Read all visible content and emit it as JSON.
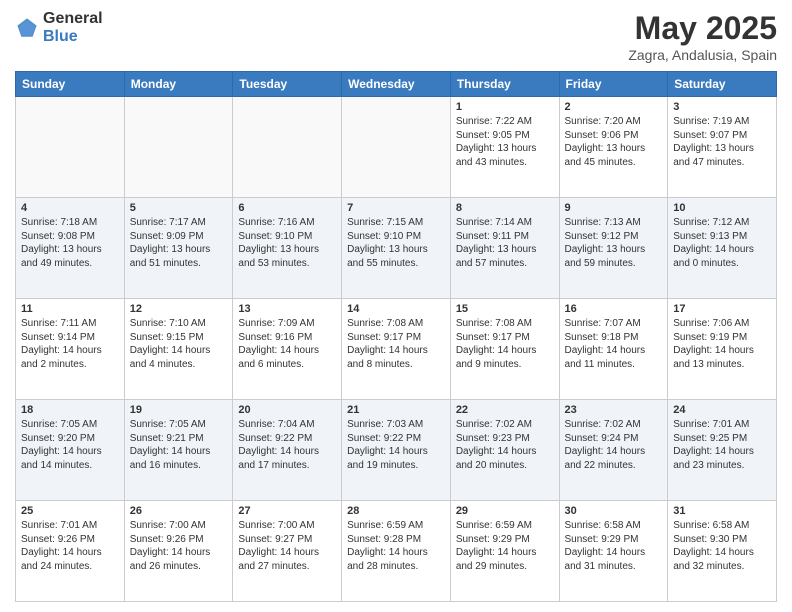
{
  "logo": {
    "general": "General",
    "blue": "Blue"
  },
  "title": "May 2025",
  "location": "Zagra, Andalusia, Spain",
  "days_of_week": [
    "Sunday",
    "Monday",
    "Tuesday",
    "Wednesday",
    "Thursday",
    "Friday",
    "Saturday"
  ],
  "weeks": [
    [
      {
        "day": "",
        "info": ""
      },
      {
        "day": "",
        "info": ""
      },
      {
        "day": "",
        "info": ""
      },
      {
        "day": "",
        "info": ""
      },
      {
        "day": "1",
        "info": "Sunrise: 7:22 AM\nSunset: 9:05 PM\nDaylight: 13 hours\nand 43 minutes."
      },
      {
        "day": "2",
        "info": "Sunrise: 7:20 AM\nSunset: 9:06 PM\nDaylight: 13 hours\nand 45 minutes."
      },
      {
        "day": "3",
        "info": "Sunrise: 7:19 AM\nSunset: 9:07 PM\nDaylight: 13 hours\nand 47 minutes."
      }
    ],
    [
      {
        "day": "4",
        "info": "Sunrise: 7:18 AM\nSunset: 9:08 PM\nDaylight: 13 hours\nand 49 minutes."
      },
      {
        "day": "5",
        "info": "Sunrise: 7:17 AM\nSunset: 9:09 PM\nDaylight: 13 hours\nand 51 minutes."
      },
      {
        "day": "6",
        "info": "Sunrise: 7:16 AM\nSunset: 9:10 PM\nDaylight: 13 hours\nand 53 minutes."
      },
      {
        "day": "7",
        "info": "Sunrise: 7:15 AM\nSunset: 9:10 PM\nDaylight: 13 hours\nand 55 minutes."
      },
      {
        "day": "8",
        "info": "Sunrise: 7:14 AM\nSunset: 9:11 PM\nDaylight: 13 hours\nand 57 minutes."
      },
      {
        "day": "9",
        "info": "Sunrise: 7:13 AM\nSunset: 9:12 PM\nDaylight: 13 hours\nand 59 minutes."
      },
      {
        "day": "10",
        "info": "Sunrise: 7:12 AM\nSunset: 9:13 PM\nDaylight: 14 hours\nand 0 minutes."
      }
    ],
    [
      {
        "day": "11",
        "info": "Sunrise: 7:11 AM\nSunset: 9:14 PM\nDaylight: 14 hours\nand 2 minutes."
      },
      {
        "day": "12",
        "info": "Sunrise: 7:10 AM\nSunset: 9:15 PM\nDaylight: 14 hours\nand 4 minutes."
      },
      {
        "day": "13",
        "info": "Sunrise: 7:09 AM\nSunset: 9:16 PM\nDaylight: 14 hours\nand 6 minutes."
      },
      {
        "day": "14",
        "info": "Sunrise: 7:08 AM\nSunset: 9:17 PM\nDaylight: 14 hours\nand 8 minutes."
      },
      {
        "day": "15",
        "info": "Sunrise: 7:08 AM\nSunset: 9:17 PM\nDaylight: 14 hours\nand 9 minutes."
      },
      {
        "day": "16",
        "info": "Sunrise: 7:07 AM\nSunset: 9:18 PM\nDaylight: 14 hours\nand 11 minutes."
      },
      {
        "day": "17",
        "info": "Sunrise: 7:06 AM\nSunset: 9:19 PM\nDaylight: 14 hours\nand 13 minutes."
      }
    ],
    [
      {
        "day": "18",
        "info": "Sunrise: 7:05 AM\nSunset: 9:20 PM\nDaylight: 14 hours\nand 14 minutes."
      },
      {
        "day": "19",
        "info": "Sunrise: 7:05 AM\nSunset: 9:21 PM\nDaylight: 14 hours\nand 16 minutes."
      },
      {
        "day": "20",
        "info": "Sunrise: 7:04 AM\nSunset: 9:22 PM\nDaylight: 14 hours\nand 17 minutes."
      },
      {
        "day": "21",
        "info": "Sunrise: 7:03 AM\nSunset: 9:22 PM\nDaylight: 14 hours\nand 19 minutes."
      },
      {
        "day": "22",
        "info": "Sunrise: 7:02 AM\nSunset: 9:23 PM\nDaylight: 14 hours\nand 20 minutes."
      },
      {
        "day": "23",
        "info": "Sunrise: 7:02 AM\nSunset: 9:24 PM\nDaylight: 14 hours\nand 22 minutes."
      },
      {
        "day": "24",
        "info": "Sunrise: 7:01 AM\nSunset: 9:25 PM\nDaylight: 14 hours\nand 23 minutes."
      }
    ],
    [
      {
        "day": "25",
        "info": "Sunrise: 7:01 AM\nSunset: 9:26 PM\nDaylight: 14 hours\nand 24 minutes."
      },
      {
        "day": "26",
        "info": "Sunrise: 7:00 AM\nSunset: 9:26 PM\nDaylight: 14 hours\nand 26 minutes."
      },
      {
        "day": "27",
        "info": "Sunrise: 7:00 AM\nSunset: 9:27 PM\nDaylight: 14 hours\nand 27 minutes."
      },
      {
        "day": "28",
        "info": "Sunrise: 6:59 AM\nSunset: 9:28 PM\nDaylight: 14 hours\nand 28 minutes."
      },
      {
        "day": "29",
        "info": "Sunrise: 6:59 AM\nSunset: 9:29 PM\nDaylight: 14 hours\nand 29 minutes."
      },
      {
        "day": "30",
        "info": "Sunrise: 6:58 AM\nSunset: 9:29 PM\nDaylight: 14 hours\nand 31 minutes."
      },
      {
        "day": "31",
        "info": "Sunrise: 6:58 AM\nSunset: 9:30 PM\nDaylight: 14 hours\nand 32 minutes."
      }
    ]
  ]
}
